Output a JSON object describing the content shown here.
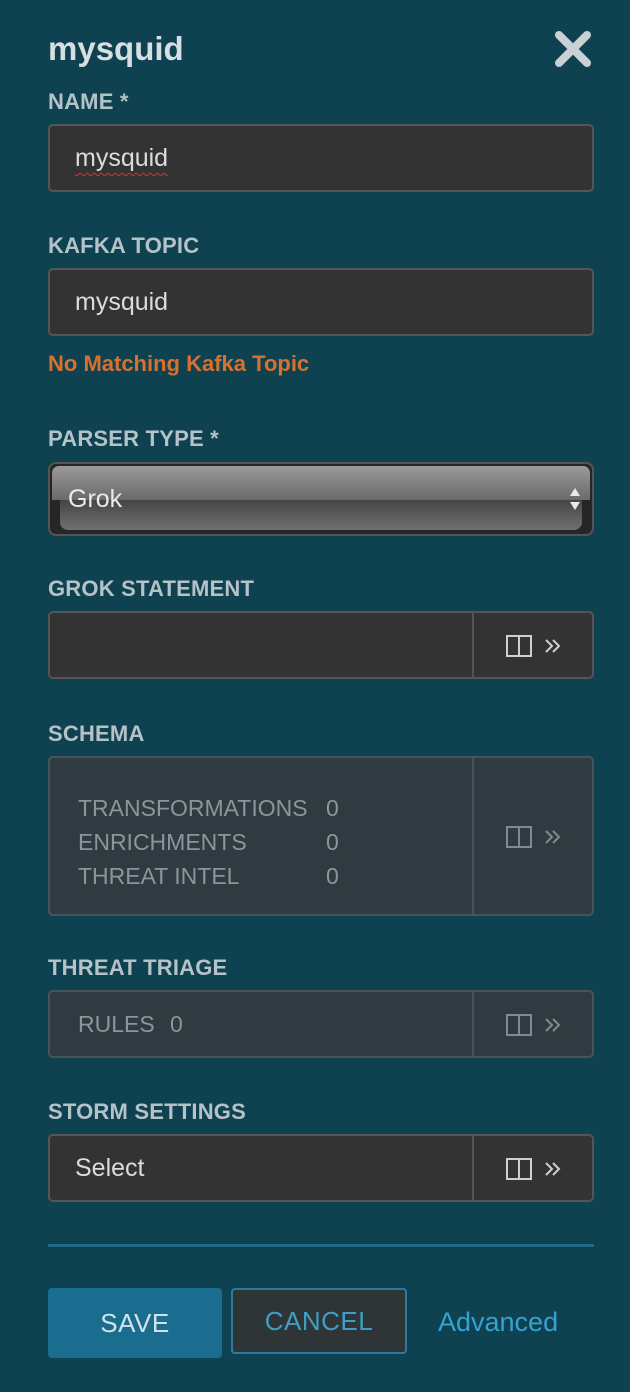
{
  "panel": {
    "title": "mysquid"
  },
  "name_field": {
    "label": "NAME *",
    "value": "mysquid"
  },
  "kafka_field": {
    "label": "KAFKA TOPIC",
    "value": "mysquid",
    "warning": "No Matching Kafka Topic"
  },
  "parser_field": {
    "label": "PARSER TYPE *",
    "value": "Grok"
  },
  "grok_field": {
    "label": "GROK STATEMENT",
    "value": ""
  },
  "schema": {
    "label": "SCHEMA",
    "rows": [
      {
        "name": "TRANSFORMATIONS",
        "count": "0"
      },
      {
        "name": "ENRICHMENTS",
        "count": "0"
      },
      {
        "name": "THREAT INTEL",
        "count": "0"
      }
    ]
  },
  "threat_triage": {
    "label": "THREAT TRIAGE",
    "rules_label": "RULES",
    "rules_count": "0"
  },
  "storm_settings": {
    "label": "STORM SETTINGS",
    "value": "Select"
  },
  "actions": {
    "save": "SAVE",
    "cancel": "CANCEL",
    "advanced": "Advanced"
  },
  "colors": {
    "background": "#0f4251",
    "warning": "#d9702d",
    "accent": "#35a2d1"
  },
  "icons": {
    "close": "close-icon",
    "expand": "expand-pane-icon"
  }
}
